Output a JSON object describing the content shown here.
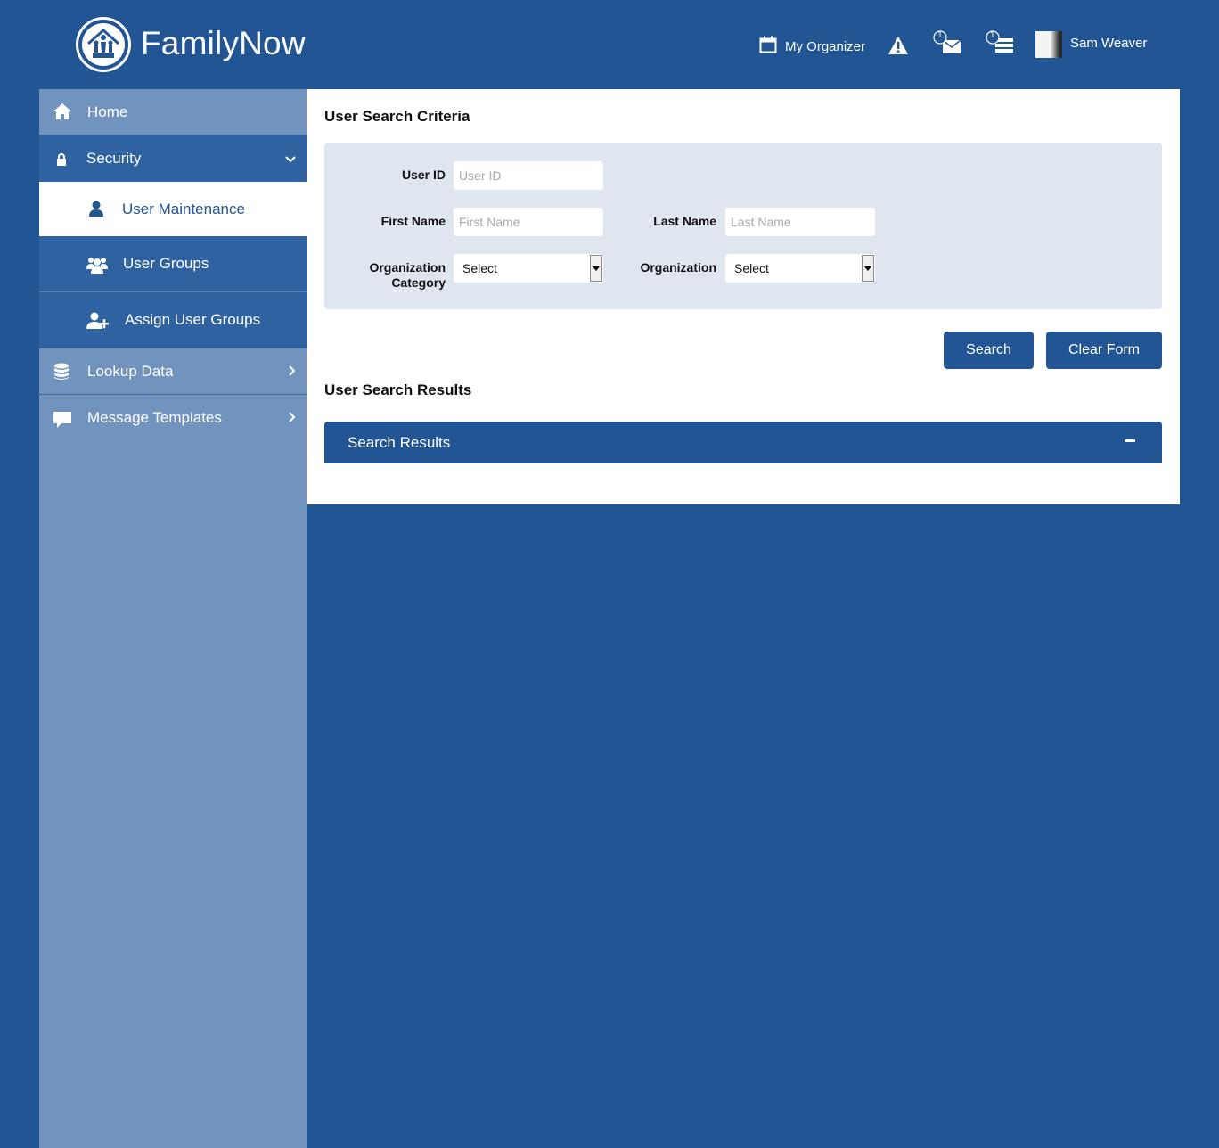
{
  "header": {
    "app_title": "FamilyNow",
    "organizer_label": "My Organizer",
    "user_name": "Sam Weaver",
    "messages_count": "1",
    "tasks_count": "1"
  },
  "sidebar": {
    "items": [
      {
        "label": "Home",
        "icon": "home-icon"
      },
      {
        "label": "Security",
        "icon": "lock-icon",
        "expanded": true
      },
      {
        "label": "User Maintenance",
        "icon": "user-icon",
        "active": true
      },
      {
        "label": "User Groups",
        "icon": "users-icon"
      },
      {
        "label": "Assign User Groups",
        "icon": "user-plus-icon"
      },
      {
        "label": "Lookup Data",
        "icon": "database-icon"
      },
      {
        "label": "Message Templates",
        "icon": "comment-icon"
      }
    ]
  },
  "main": {
    "criteria_title": "User Search Criteria",
    "fields": {
      "user_id": {
        "label": "User ID",
        "placeholder": "User ID",
        "value": ""
      },
      "first_name": {
        "label": "First Name",
        "placeholder": "First Name",
        "value": ""
      },
      "last_name": {
        "label": "Last Name",
        "placeholder": "Last Name",
        "value": ""
      },
      "org_category": {
        "label_line1": "Organization",
        "label_line2": "Category",
        "value": "Select"
      },
      "organization": {
        "label": "Organization",
        "value": "Select"
      }
    },
    "search_button": "Search",
    "clear_button": "Clear Form",
    "results_title": "User Search Results",
    "results_panel_title": "Search Results"
  },
  "colors": {
    "brand": "#225594",
    "sidebar": "#7194bf",
    "submenu": "#2f62a0",
    "criteria_bg": "#dfe6ef"
  }
}
